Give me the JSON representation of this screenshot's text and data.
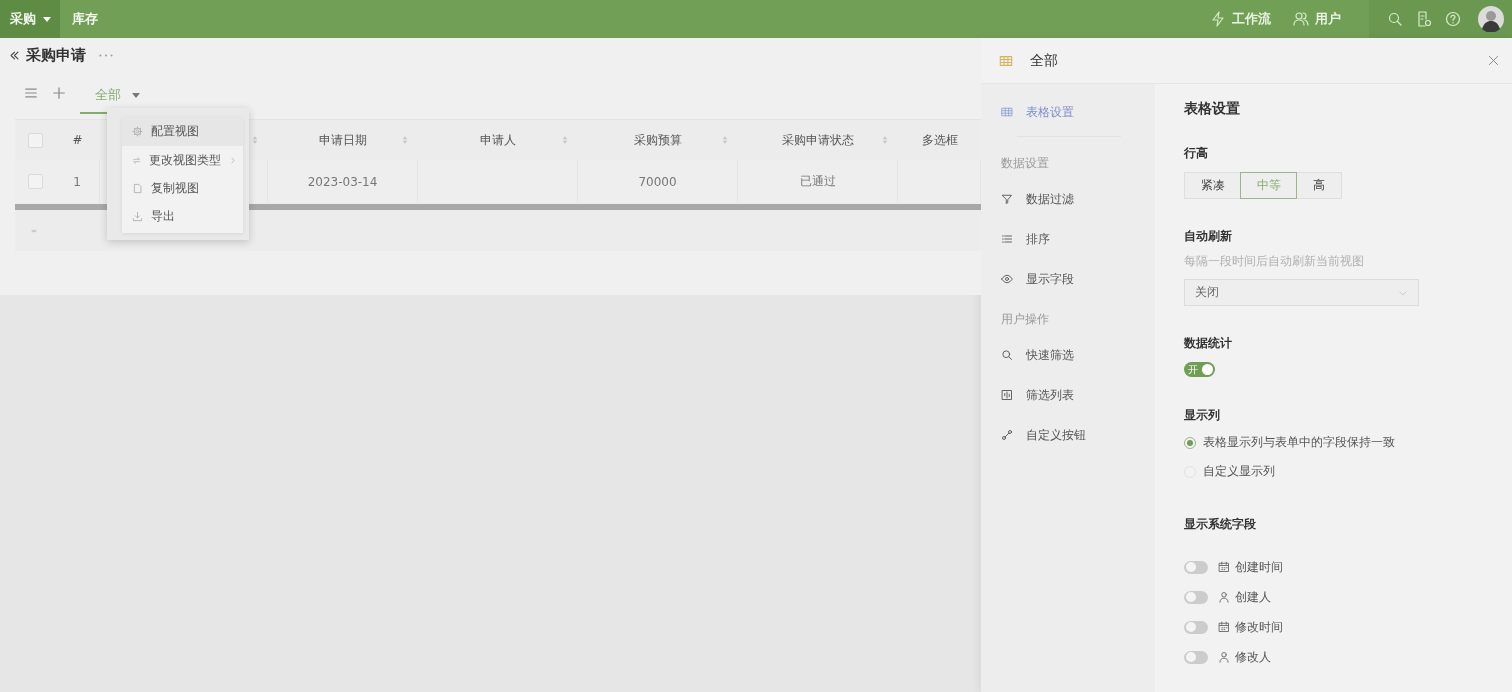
{
  "top_bar": {
    "apps": [
      {
        "label": "采购",
        "selected": true
      },
      {
        "label": "库存",
        "selected": false
      }
    ],
    "links": [
      {
        "label": "工作流"
      },
      {
        "label": "用户"
      }
    ]
  },
  "page": {
    "title": "采购申请"
  },
  "views": {
    "tabs": [
      {
        "label": "全部",
        "selected": true
      }
    ]
  },
  "table": {
    "header_checked": false,
    "columns": [
      {
        "label": "#"
      },
      {
        "sortable": true
      },
      {
        "label": "申请日期",
        "sortable": true
      },
      {
        "label": "申请人",
        "sortable": true
      },
      {
        "label": "采购预算",
        "sortable": true
      },
      {
        "label": "采购申请状态",
        "sortable": true
      },
      {
        "label": "多选框"
      }
    ],
    "rows": [
      {
        "checked": false,
        "cells": [
          "1",
          null,
          "2023-03-14",
          null,
          "70000",
          "已通过",
          null
        ]
      }
    ]
  },
  "context_menu": {
    "items": [
      {
        "label": "配置视图",
        "highlighted": true,
        "submenu": false
      },
      {
        "label": "更改视图类型",
        "highlighted": false,
        "submenu": true
      },
      {
        "label": "复制视图",
        "highlighted": false,
        "submenu": false
      },
      {
        "label": "导出",
        "highlighted": false,
        "submenu": false
      }
    ]
  },
  "panel": {
    "title": "全部",
    "nav_top": {
      "label": "表格设置",
      "selected": true
    },
    "nav_groups": [
      {
        "title": "数据设置",
        "items": [
          {
            "label": "数据过滤",
            "selected": false
          },
          {
            "label": "排序",
            "selected": false
          },
          {
            "label": "显示字段",
            "selected": false
          }
        ]
      },
      {
        "title": "用户操作",
        "items": [
          {
            "label": "快速筛选",
            "selected": false
          },
          {
            "label": "筛选列表",
            "selected": false
          },
          {
            "label": "自定义按钮",
            "selected": false
          }
        ]
      }
    ],
    "heading": "表格设置",
    "row_height": {
      "label": "行高",
      "options": [
        {
          "label": "紧凑",
          "selected": false
        },
        {
          "label": "中等",
          "selected": true
        },
        {
          "label": "高",
          "selected": false
        }
      ]
    },
    "auto_refresh": {
      "label": "自动刷新",
      "hint": "每隔一段时间后自动刷新当前视图",
      "value": "关闭"
    },
    "statistics": {
      "label": "数据统计",
      "on": true,
      "on_text": "开"
    },
    "columns_display": {
      "label": "显示列",
      "options": [
        {
          "label": "表格显示列与表单中的字段保持一致",
          "selected": true
        },
        {
          "label": "自定义显示列",
          "selected": false
        }
      ]
    },
    "system_fields": {
      "label": "显示系统字段",
      "items": [
        {
          "label": "创建时间",
          "on": false
        },
        {
          "label": "创建人",
          "on": false
        },
        {
          "label": "修改时间",
          "on": false
        },
        {
          "label": "修改人",
          "on": false
        }
      ]
    }
  }
}
